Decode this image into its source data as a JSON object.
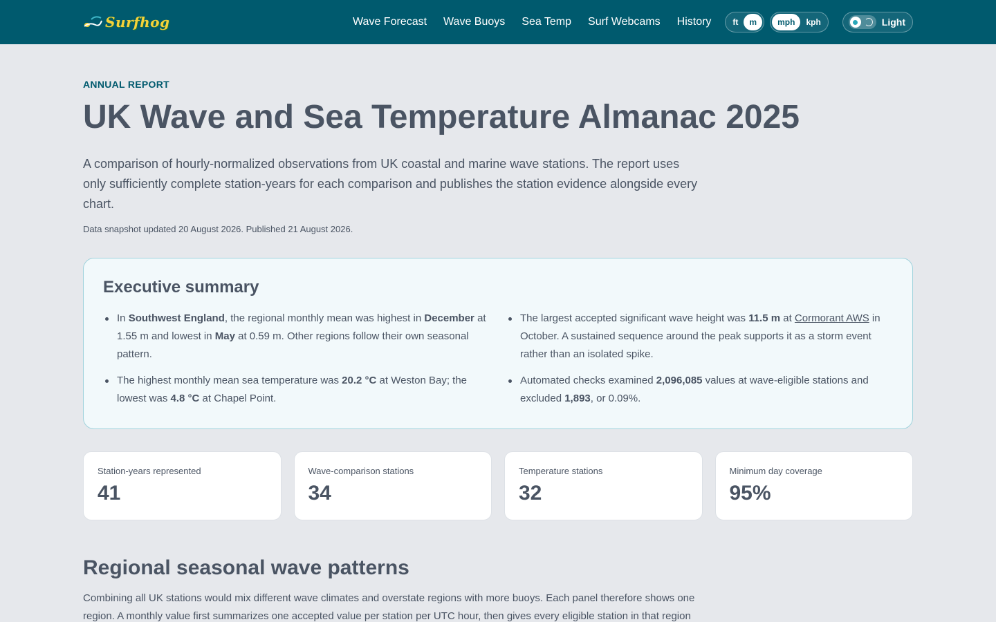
{
  "header": {
    "logo_text": "Surfhog",
    "nav": [
      {
        "label": "Wave Forecast"
      },
      {
        "label": "Wave Buoys"
      },
      {
        "label": "Sea Temp"
      },
      {
        "label": "Surf Webcams"
      },
      {
        "label": "History"
      }
    ],
    "height_units": {
      "options": [
        "ft",
        "m"
      ],
      "selected": "m"
    },
    "speed_units": {
      "options": [
        "mph",
        "kph"
      ],
      "selected": "mph"
    },
    "theme": {
      "label": "Light"
    }
  },
  "page": {
    "eyebrow": "ANNUAL REPORT",
    "title": "UK Wave and Sea Temperature Almanac 2025",
    "lede": "A comparison of hourly-normalized observations from UK coastal and marine wave stations. The report uses only sufficiently complete station-years for each comparison and publishes the station evidence alongside every chart.",
    "meta": "Data snapshot updated 20 August 2026. Published 21 August 2026."
  },
  "summary": {
    "heading": "Executive summary",
    "items": [
      {
        "t1": "In ",
        "b1": "Southwest England",
        "t2": ", the regional monthly mean was highest in ",
        "b2": "December",
        "t3": " at 1.55 m and lowest in ",
        "b3": "May",
        "t4": " at 0.59 m. Other regions follow their own seasonal pattern."
      },
      {
        "t1": "The largest accepted significant wave height was ",
        "b1": "11.5 m",
        "t2": " at ",
        "link": "Cormorant AWS",
        "t3": " in October. A sustained sequence around the peak supports it as a storm event rather than an isolated spike."
      },
      {
        "t1": "The highest monthly mean sea temperature was ",
        "b1": "20.2 °C",
        "t2": " at Weston Bay; the lowest was ",
        "b2": "4.8 °C",
        "t3": " at Chapel Point."
      },
      {
        "t1": "Automated checks examined ",
        "b1": "2,096,085",
        "t2": " values at wave-eligible stations and excluded ",
        "b2": "1,893",
        "t3": ", or 0.09%."
      }
    ]
  },
  "stats": [
    {
      "label": "Station-years represented",
      "value": "41"
    },
    {
      "label": "Wave-comparison stations",
      "value": "34"
    },
    {
      "label": "Temperature stations",
      "value": "32"
    },
    {
      "label": "Minimum day coverage",
      "value": "95%"
    }
  ],
  "section": {
    "heading": "Regional seasonal wave patterns",
    "text": "Combining all UK stations would mix different wave climates and overstate regions with more buoys. Each panel therefore shows one region. A monthly value first summarizes one accepted value per station per UTC hour, then gives every eligible station in that region equal weight."
  },
  "colors": {
    "header_bg": "#005a6e",
    "page_bg": "#e6e8ec",
    "accent": "#005a6e",
    "summary_bg": "#f2f9fb",
    "summary_border": "#9fd2dc",
    "text": "#4a5463"
  }
}
